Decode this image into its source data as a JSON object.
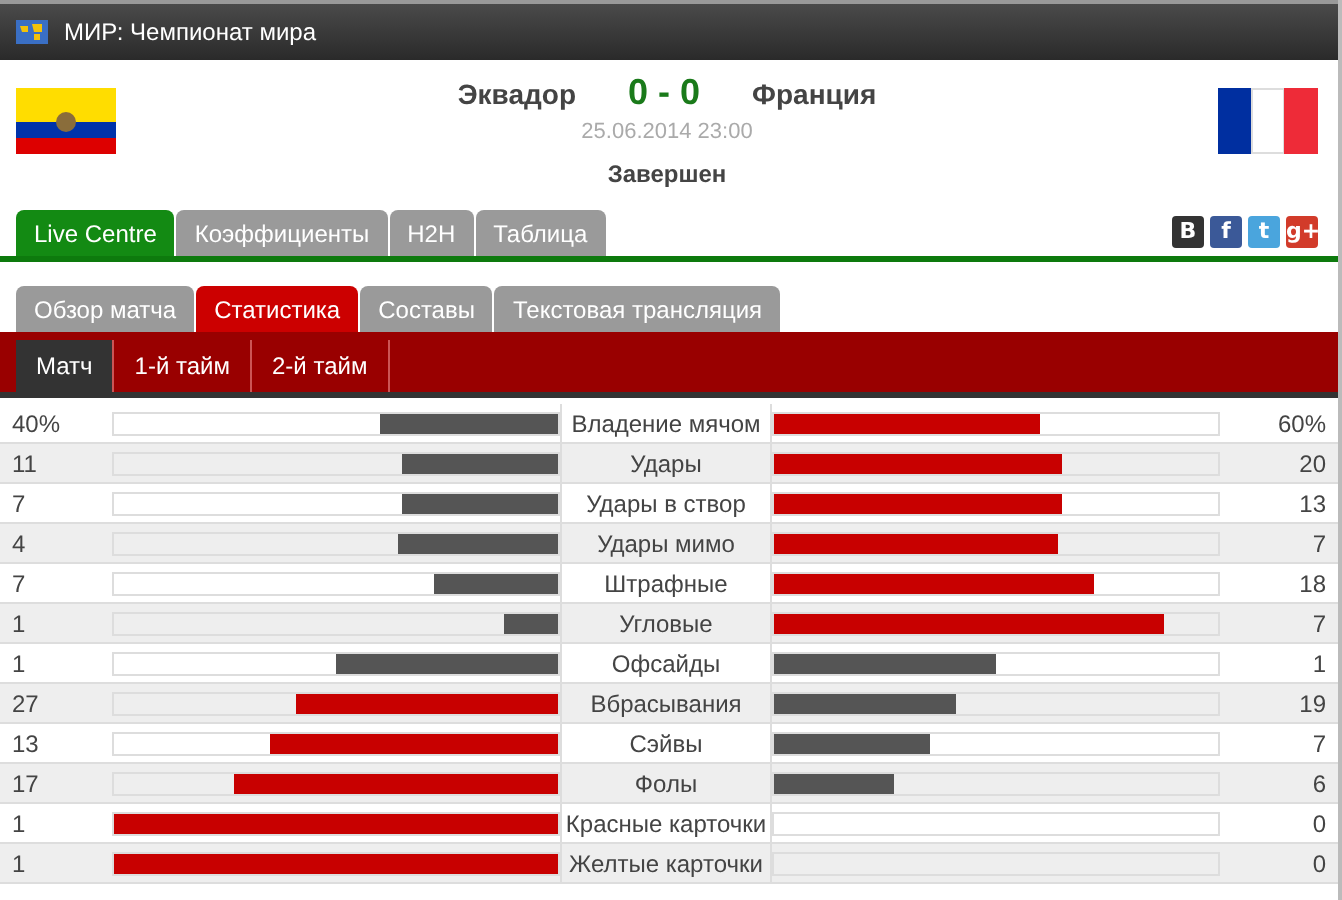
{
  "header": {
    "title": "МИР: Чемпионат мира"
  },
  "match": {
    "home": "Эквадор",
    "score": "0 - 0",
    "away": "Франция",
    "datetime": "25.06.2014 23:00",
    "status": "Завершен"
  },
  "main_tabs": [
    {
      "label": "Live Centre",
      "selected": true
    },
    {
      "label": "Коэффициенты",
      "selected": false
    },
    {
      "label": "H2H",
      "selected": false
    },
    {
      "label": "Таблица",
      "selected": false
    }
  ],
  "share": [
    {
      "kind": "vk",
      "label": "B"
    },
    {
      "kind": "facebook",
      "label": "f"
    },
    {
      "kind": "twitter",
      "label": "t"
    },
    {
      "kind": "gplus",
      "label": "g+"
    }
  ],
  "section_tabs": [
    {
      "label": "Обзор матча",
      "selected": false
    },
    {
      "label": "Статистика",
      "selected": true
    },
    {
      "label": "Составы",
      "selected": false
    },
    {
      "label": "Текстовая трансляция",
      "selected": false
    }
  ],
  "period_tabs": [
    {
      "label": "Матч",
      "selected": true
    },
    {
      "label": "1-й тайм",
      "selected": false
    },
    {
      "label": "2-й тайм",
      "selected": false
    }
  ],
  "stats": [
    {
      "label": "Владение мячом",
      "home": {
        "value": "40%",
        "level": 0.4,
        "leading": false
      },
      "away": {
        "value": "60%",
        "level": 0.6,
        "leading": true
      }
    },
    {
      "label": "Удары",
      "home": {
        "value": "11",
        "level": 0.35,
        "leading": false
      },
      "away": {
        "value": "20",
        "level": 0.65,
        "leading": true
      }
    },
    {
      "label": "Удары в створ",
      "home": {
        "value": "7",
        "level": 0.35,
        "leading": false
      },
      "away": {
        "value": "13",
        "level": 0.65,
        "leading": true
      }
    },
    {
      "label": "Удары мимо",
      "home": {
        "value": "4",
        "level": 0.36,
        "leading": false
      },
      "away": {
        "value": "7",
        "level": 0.64,
        "leading": true
      }
    },
    {
      "label": "Штрафные",
      "home": {
        "value": "7",
        "level": 0.28,
        "leading": false
      },
      "away": {
        "value": "18",
        "level": 0.72,
        "leading": true
      }
    },
    {
      "label": "Угловые",
      "home": {
        "value": "1",
        "level": 0.12,
        "leading": false
      },
      "away": {
        "value": "7",
        "level": 0.88,
        "leading": true
      }
    },
    {
      "label": "Офсайды",
      "home": {
        "value": "1",
        "level": 0.5,
        "leading": false
      },
      "away": {
        "value": "1",
        "level": 0.5,
        "leading": false
      }
    },
    {
      "label": "Вбрасывания",
      "home": {
        "value": "27",
        "level": 0.59,
        "leading": true
      },
      "away": {
        "value": "19",
        "level": 0.41,
        "leading": false
      }
    },
    {
      "label": "Сэйвы",
      "home": {
        "value": "13",
        "level": 0.65,
        "leading": true
      },
      "away": {
        "value": "7",
        "level": 0.35,
        "leading": false
      }
    },
    {
      "label": "Фолы",
      "home": {
        "value": "17",
        "level": 0.73,
        "leading": true
      },
      "away": {
        "value": "6",
        "level": 0.27,
        "leading": false
      }
    },
    {
      "label": "Красные карточки",
      "home": {
        "value": "1",
        "level": 1,
        "leading": true
      },
      "away": {
        "value": "0"
      }
    },
    {
      "label": "Желтые карточки",
      "home": {
        "value": "1",
        "level": 1,
        "leading": true
      },
      "away": {
        "value": "0"
      }
    }
  ]
}
